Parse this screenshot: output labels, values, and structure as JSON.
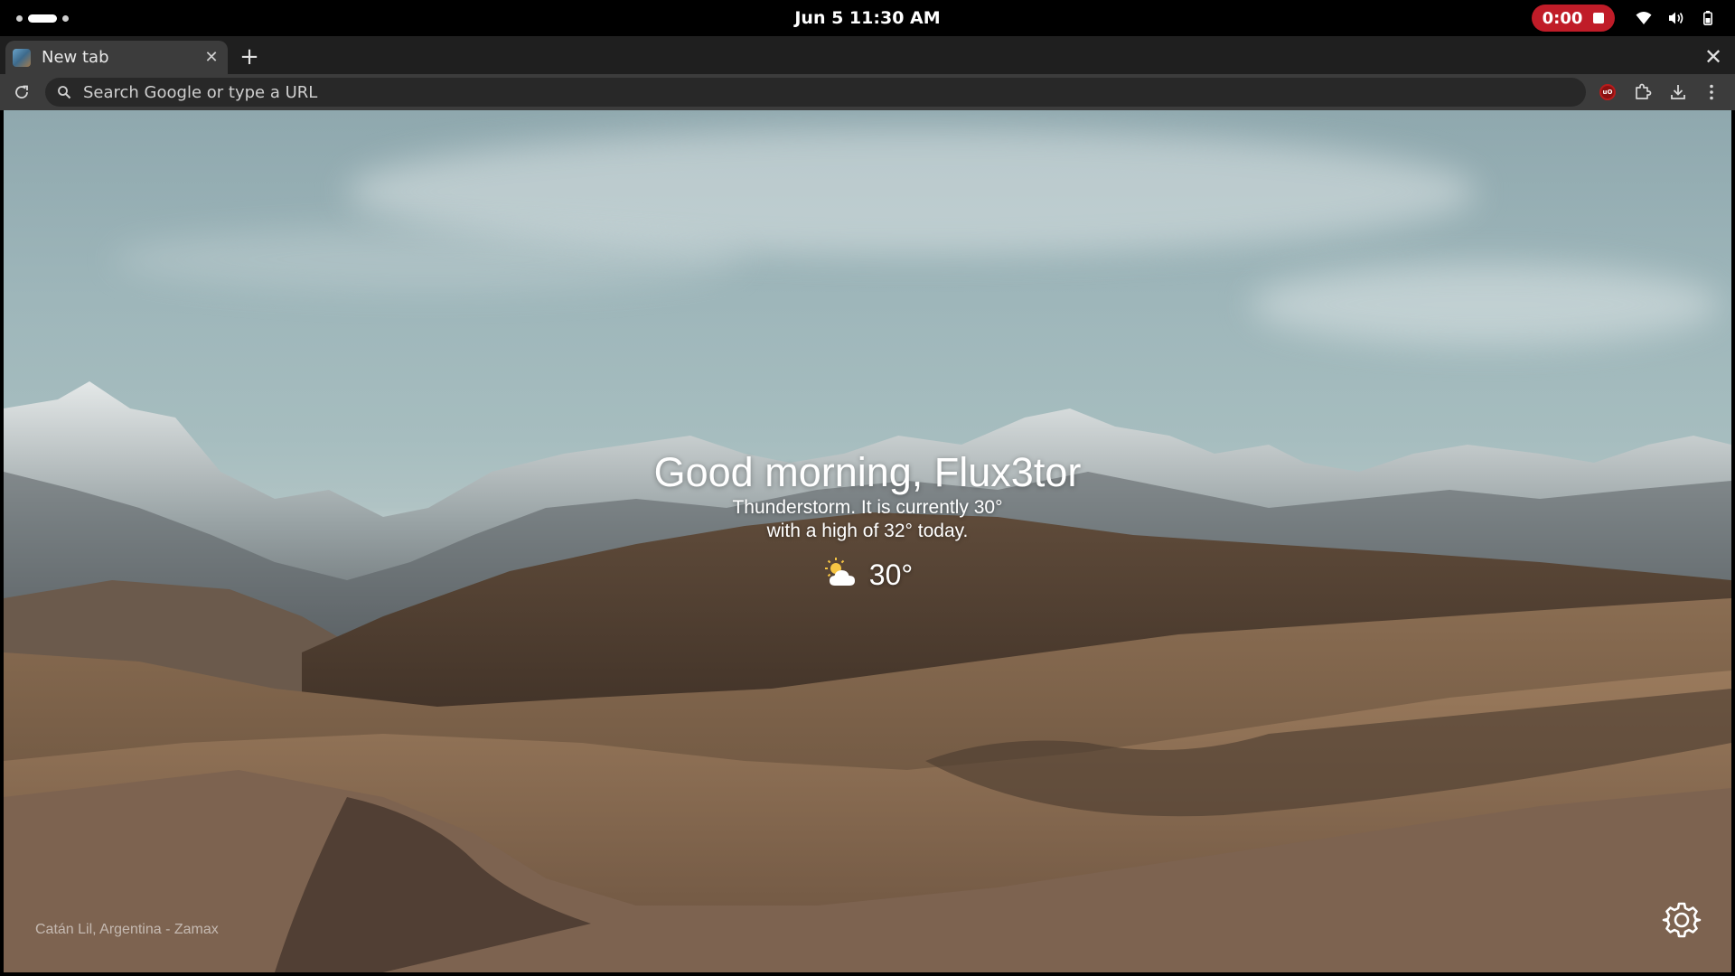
{
  "system_bar": {
    "clock": "Jun 5  11:30 AM",
    "recording_timer": "0:00",
    "icons": [
      "workspace-indicator",
      "wifi-icon",
      "volume-icon",
      "battery-icon",
      "stop-icon"
    ]
  },
  "browser": {
    "tab": {
      "title": "New tab",
      "close_glyph": "✕"
    },
    "new_tab_glyph": "+",
    "window_close_glyph": "✕",
    "omnibox": {
      "placeholder": "Search Google or type a URL",
      "value": ""
    },
    "toolbar_icons": [
      "reload-icon",
      "search-icon",
      "ublock-extension-icon",
      "extensions-puzzle-icon",
      "download-icon",
      "kebab-menu-icon"
    ],
    "ublock_badge": "uO"
  },
  "page": {
    "greeting": "Good morning, Flux3tor",
    "weather_summary_line1": "Thunderstorm. It is currently 30°",
    "weather_summary_line2": "with a high of 32° today.",
    "weather_temp": "30°",
    "weather_icon": "partly-cloudy-sun-icon",
    "photo_credit": "Catán Lil, Argentina - Zamax",
    "settings_icon": "gear-icon"
  },
  "colors": {
    "recording": "#c01c28",
    "tab_bg": "#3c3c3c",
    "toolbar_bg": "#3c3c3c",
    "tabstrip_bg": "#1f1f1f",
    "omnibox_bg": "#282828"
  }
}
